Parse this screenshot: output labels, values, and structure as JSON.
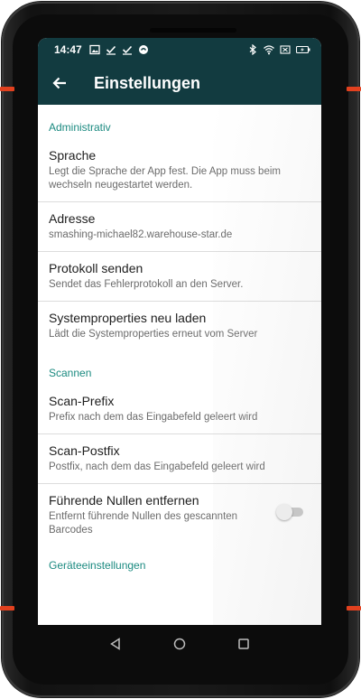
{
  "status_bar": {
    "time": "14:47",
    "left_icons": [
      "image-icon",
      "check-icon",
      "check-icon",
      "sync-icon"
    ],
    "right_icons": [
      "bluetooth-icon",
      "wifi-icon",
      "no-sim-icon",
      "battery-charging-icon"
    ]
  },
  "app_bar": {
    "title": "Einstellungen",
    "back_icon": "arrow-back-icon"
  },
  "sections": {
    "administrativ": {
      "header": "Administrativ",
      "items": [
        {
          "title": "Sprache",
          "summary": "Legt die Sprache der App fest. Die App muss beim wechseln neugestartet werden."
        },
        {
          "title": "Adresse",
          "summary": "smashing-michael82.warehouse-star.de"
        },
        {
          "title": "Protokoll senden",
          "summary": "Sendet das Fehlerprotokoll an den Server."
        },
        {
          "title": "Systemproperties neu laden",
          "summary": "Lädt die Systemproperties erneut vom Server"
        }
      ]
    },
    "scannen": {
      "header": "Scannen",
      "items": [
        {
          "title": "Scan-Prefix",
          "summary": "Prefix nach dem das Eingabefeld geleert wird"
        },
        {
          "title": "Scan-Postfix",
          "summary": "Postfix, nach dem das Eingabefeld geleert wird"
        },
        {
          "title": "Führende Nullen entfernen",
          "summary": "Entfernt führende Nullen des gescannten Barcodes",
          "switch_on": false
        }
      ]
    },
    "geraete": {
      "header": "Geräteeinstellungen"
    }
  },
  "nav_bar": {
    "icons": [
      "back-triangle-icon",
      "home-circle-icon",
      "recents-square-icon"
    ]
  },
  "colors": {
    "app_bar": "#123b40",
    "section_header": "#1b8a80",
    "device_accent": "#e2411f"
  }
}
